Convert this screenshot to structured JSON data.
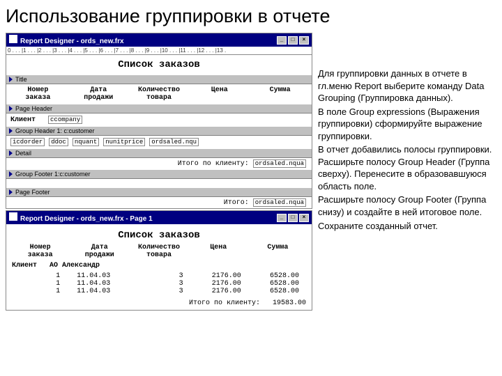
{
  "slide_title": "Использование группировки в отчете",
  "designer": {
    "title": "Report Designer - ords_new.frx",
    "ruler": "0 . . . |1 . . . |2 . . . |3 . . . |4 . . . |5 . . . |6 . . . |7 . . . |8 . . . |9 . . . |10 . . . |11 . . . |12 . . . |13 .",
    "report_heading": "Список заказов",
    "bands": {
      "title": "Title",
      "page_header": "Page Header",
      "group_header": "Group Header 1: c:customer",
      "detail": "Detail",
      "group_footer": "Group Footer 1:c:customer",
      "page_footer": "Page Footer"
    },
    "columns": {
      "c1a": "Номер",
      "c1b": "заказа",
      "c2a": "Дата",
      "c2b": "продажи",
      "c3a": "Количество",
      "c3b": "товара",
      "c4": "Цена",
      "c5": "Сумма"
    },
    "group_header_field_label": "Клиент",
    "group_header_field": "ccompany",
    "detail_fields": [
      "icdorder",
      "ddoc",
      "nquant",
      "nunitprice",
      "ordsaled.nqu"
    ],
    "group_footer_label": "Итого по клиенту:",
    "group_footer_field": "ordsaled.nqua",
    "page_footer_label": "Итого:",
    "page_footer_field": "ordsaled.nqua"
  },
  "preview": {
    "title": "Report Designer - ords_new.frx - Page 1",
    "report_heading": "Список заказов",
    "columns": {
      "c1a": "Номер",
      "c1b": "заказа",
      "c2a": "Дата",
      "c2b": "продажи",
      "c3a": "Количество",
      "c3b": "товара",
      "c4": "Цена",
      "c5": "Сумма"
    },
    "client_label": "Клиент",
    "client_value": "АО Александр",
    "rows": [
      {
        "order": "1",
        "date": "11.04.03",
        "qty": "3",
        "price": "2176.00",
        "sum": "6528.00"
      },
      {
        "order": "1",
        "date": "11.04.03",
        "qty": "3",
        "price": "2176.00",
        "sum": "6528.00"
      },
      {
        "order": "1",
        "date": "11.04.03",
        "qty": "3",
        "price": "2176.00",
        "sum": "6528.00"
      }
    ],
    "footer_label": "Итого по клиенту:",
    "footer_total": "19583.00"
  },
  "instructions": {
    "p1": "Для группировки данных в отчете в гл.меню Report выберите команду Data Grouping (Группировка данных).",
    "p2": "В поле Group expressions (Выражения группировки) сформируйте выражение группировки.",
    "p3": "В отчет добавились полосы группировки. Расширьте полосу Group Header (Группа сверху). Перенесите в образовавшуюся область поле.",
    "p4": "Расширьте полосу Group Footer (Группа снизу) и создайте в ней итоговое поле.",
    "p5": "Сохраните созданный отчет."
  },
  "win_buttons": {
    "min": "_",
    "max": "□",
    "close": "×"
  }
}
